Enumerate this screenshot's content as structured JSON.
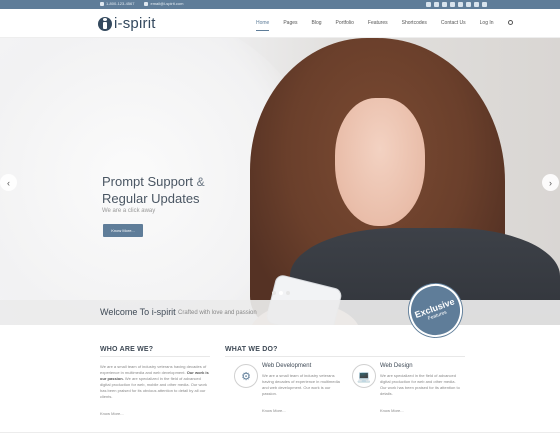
{
  "topbar": {
    "phone": "1-800-123-4567",
    "email": "email@i-spirit.com",
    "social_icons": [
      "facebook-icon",
      "twitter-icon",
      "google-plus-icon",
      "dribbble-icon",
      "pinterest-icon",
      "linkedin-icon",
      "instagram-icon",
      "rss-icon"
    ]
  },
  "header": {
    "logo": "i-spirit",
    "nav": [
      "Home",
      "Pages",
      "Blog",
      "Portfolio",
      "Features",
      "Shortcodes",
      "Contact Us",
      "Log In"
    ]
  },
  "hero": {
    "headline_1": "Prompt Support",
    "headline_amp": "&",
    "headline_2": "Regular Updates",
    "subline": "We are a click away",
    "button": "Know More...",
    "slides_total": 3,
    "slide_active": 2
  },
  "welcome": {
    "title": "Welcome To i-spirit",
    "subtitle": "Crafted with love and passion"
  },
  "badge": {
    "title": "Exclusive",
    "sub": "Features"
  },
  "who": {
    "title": "WHO ARE WE?",
    "text_start": "We are a small team of industry veterans having decades of experience in multimedia and web development.",
    "text_bold": "Our work is our passion.",
    "text_end": "We are specialized in the field of advanced digital production for web, mobile and other media. Our work has been praised for its obvious attention to detail by all our clients.",
    "more": "Know More..."
  },
  "what": {
    "title": "WHAT WE DO?",
    "services": [
      {
        "title": "Web Development",
        "text": "We are a small team of industry veterans having decades of experience in multimedia and web development. Our work is our passion.",
        "more": "Know More..."
      },
      {
        "title": "Web Design",
        "text": "We are specialized in the field of advanced digital production for web and other media. Our work has been praised for its attention to details.",
        "more": "Know More..."
      }
    ]
  },
  "colors": {
    "accent": "#5f7d99",
    "heading": "#3f4a56"
  }
}
